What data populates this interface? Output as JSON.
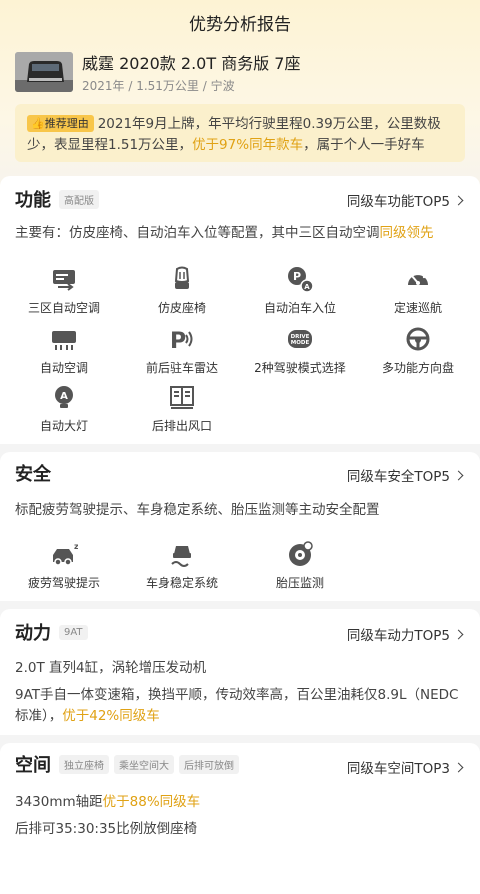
{
  "header": {
    "title": "优势分析报告"
  },
  "car": {
    "name": "威霆 2020款 2.0T 商务版 7座",
    "meta": "2021年 / 1.51万公里 / 宁波"
  },
  "reason": {
    "badge": "推荐理由",
    "text_a": "2021年9月上牌，年平均行驶里程0.39万公里，公里数极少，表显里程1.51万公里，",
    "highlight": "优于97%同年款车",
    "text_b": "，属于个人一手好车"
  },
  "function": {
    "title": "功能",
    "tag": "高配版",
    "link": "同级车功能TOP5",
    "desc_a": "主要有：仿皮座椅、自动泊车入位等配置，其中三区自动空调",
    "desc_hl": "同级领先",
    "features": [
      {
        "label": "三区自动空调",
        "icon": "climate-control-icon"
      },
      {
        "label": "仿皮座椅",
        "icon": "seat-icon"
      },
      {
        "label": "自动泊车入位",
        "icon": "auto-parking-icon"
      },
      {
        "label": "定速巡航",
        "icon": "cruise-control-icon"
      },
      {
        "label": "自动空调",
        "icon": "air-conditioning-icon"
      },
      {
        "label": "前后驻车雷达",
        "icon": "parking-radar-icon"
      },
      {
        "label": "2种驾驶模式选择",
        "icon": "drive-mode-icon"
      },
      {
        "label": "多功能方向盘",
        "icon": "steering-wheel-icon"
      },
      {
        "label": "自动大灯",
        "icon": "auto-headlight-icon"
      },
      {
        "label": "后排出风口",
        "icon": "rear-vent-icon"
      }
    ]
  },
  "safety": {
    "title": "安全",
    "link": "同级车安全TOP5",
    "desc": "标配疲劳驾驶提示、车身稳定系统、胎压监测等主动安全配置",
    "features": [
      {
        "label": "疲劳驾驶提示",
        "icon": "fatigue-alert-icon"
      },
      {
        "label": "车身稳定系统",
        "icon": "stability-control-icon"
      },
      {
        "label": "胎压监测",
        "icon": "tire-pressure-icon"
      }
    ]
  },
  "power": {
    "title": "动力",
    "tag": "9AT",
    "link": "同级车动力TOP5",
    "line1": "2.0T 直列4缸，涡轮增压发动机",
    "line2": "9AT手自一体变速箱，换挡平顺，传动效率高，百公里油耗仅8.9L（NEDC",
    "line3_a": "标准），",
    "line3_hl": "优于42%同级车"
  },
  "space": {
    "title": "空间",
    "tags": [
      "独立座椅",
      "乘坐空间大",
      "后排可放倒"
    ],
    "link": "同级车空间TOP3",
    "line1_a": "3430mm轴距",
    "line1_hl": "优于88%同级车",
    "line2": "后排可35:30:35比例放倒座椅"
  },
  "colors": {
    "accent": "#e0a215",
    "badge": "#f8c64a"
  }
}
